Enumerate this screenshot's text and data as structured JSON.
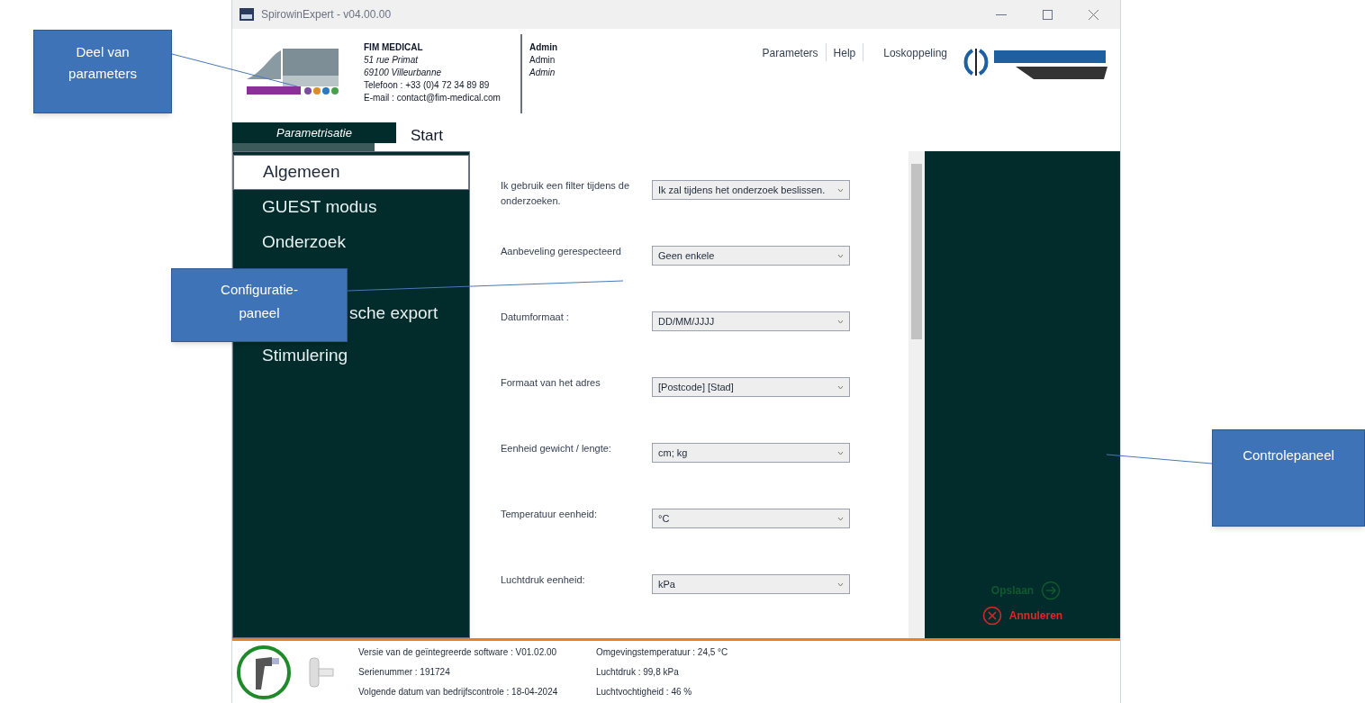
{
  "window": {
    "title": "SpirowinExpert  - v04.00.00"
  },
  "company": {
    "name": "FIM MEDICAL",
    "address_lines": [
      "51 rue Primat",
      "69100 Villeurbanne"
    ],
    "phone": "Telefoon : +33 (0)4 72 34 89 89",
    "email": "E-mail : contact@fim-medical.com"
  },
  "user": {
    "name": "Admin",
    "login": "Admin",
    "role": "Admin"
  },
  "top_links": [
    "Parameters",
    "Help",
    "Loskoppeling"
  ],
  "tabs": [
    {
      "label": "Parametrisatie",
      "selected": true
    },
    {
      "label": "Start",
      "selected": false
    }
  ],
  "sidebar": {
    "items": [
      {
        "label": "Algemeen",
        "selected": true,
        "kind": "plain"
      },
      {
        "label": "GUEST modus",
        "selected": false,
        "kind": "plain"
      },
      {
        "label": "Onderzoek",
        "selected": false,
        "kind": "plain"
      },
      {
        "label": "sche export",
        "selected": false,
        "kind": "covered"
      },
      {
        "label": "Stimulering",
        "selected": false,
        "kind": "plain"
      }
    ]
  },
  "settings": [
    {
      "label": "Ik gebruik een filter tijdens de onderzoeken.",
      "value": "Ik zal tijdens het onderzoek beslissen."
    },
    {
      "label": "Aanbeveling gerespecteerd",
      "value": "Geen  enkele"
    },
    {
      "label": "Datumformaat :",
      "value": "DD/MM/JJJJ"
    },
    {
      "label": "Formaat van het adres",
      "value": "[Postcode] [Stad]"
    },
    {
      "label": "Eenheid gewicht / lengte:",
      "value": "cm; kg"
    },
    {
      "label": "Temperatuur eenheid:",
      "value": "°C"
    },
    {
      "label": "Luchtdruk eenheid:",
      "value": "kPa"
    }
  ],
  "actions": [
    {
      "label": "Opslaan",
      "disabled": true,
      "kind": "save"
    },
    {
      "label": "Annuleren",
      "disabled": false,
      "kind": "cancel"
    }
  ],
  "footer": {
    "col1": [
      "Versie van de geïntegreerde software : V01.02.00",
      "Serienummer : 191724",
      "Volgende datum van bedrijfscontrole  : 18-04-2024"
    ],
    "col2": [
      "Omgevingstemperatuur : 24,5 °C",
      "Luchtdruk : 99,8 kPa",
      "Luchtvochtigheid : 46 %"
    ]
  },
  "callouts": [
    {
      "text": "Deel van parameters"
    },
    {
      "text": "Configuratie-paneel"
    },
    {
      "text": "Controlepaneel"
    }
  ]
}
